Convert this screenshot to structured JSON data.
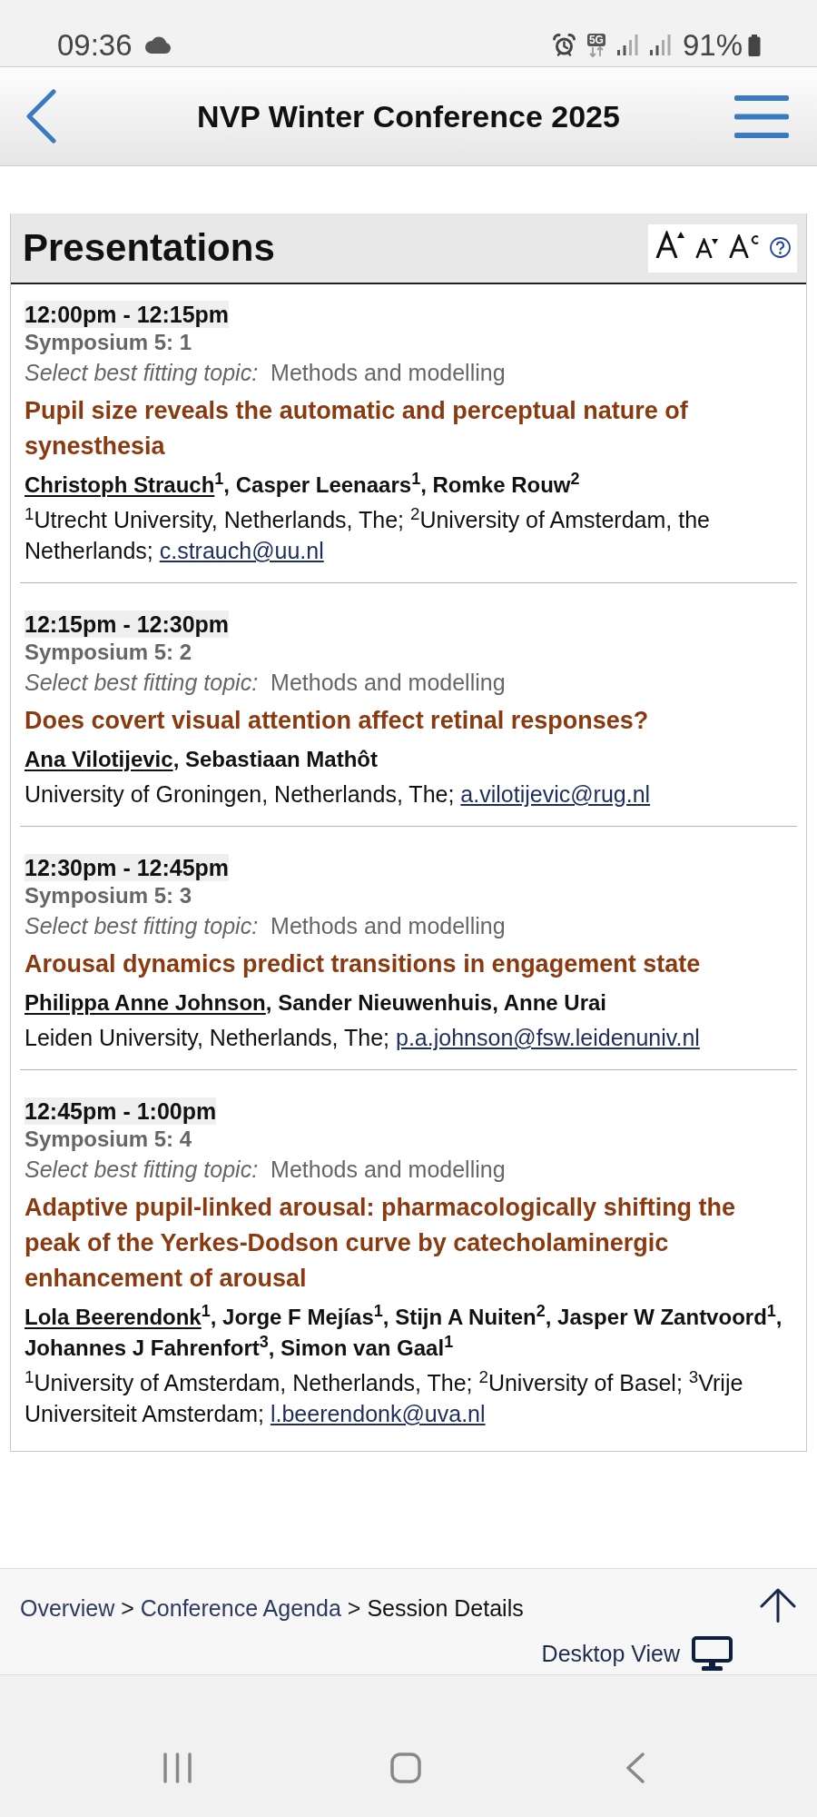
{
  "status_bar": {
    "time": "09:36",
    "network": "5G",
    "battery": "91%"
  },
  "header": {
    "title": "NVP Winter Conference 2025"
  },
  "section": {
    "title": "Presentations"
  },
  "presentations": [
    {
      "time": "12:00pm - 12:15pm",
      "session": "Symposium 5: 1",
      "topic_label": "Select best fitting topic:",
      "topic": "Methods and modelling",
      "title": "Pupil size reveals the automatic and perceptual nature of synesthesia",
      "authors": [
        {
          "name": "Christoph Strauch",
          "mark": "1",
          "presenting": true,
          "separator": ","
        },
        {
          "name": "Casper Leenaars",
          "mark": "1",
          "presenting": false,
          "separator": ","
        },
        {
          "name": "Romke Rouw",
          "mark": "2",
          "presenting": false
        }
      ],
      "affiliations": "$^{1}$Utrecht University, Netherlands, The; $^{2}$University of Amsterdam, the Netherlands;",
      "email": "c.strauch@uu.nl"
    },
    {
      "time": "12:15pm - 12:30pm",
      "session": "Symposium 5: 2",
      "topic_label": "Select best fitting topic:",
      "topic": "Methods and modelling",
      "title": "Does covert visual attention affect retinal responses?",
      "authors": [
        {
          "name": "Ana Vilotijevic",
          "presenting": true,
          "separator": ","
        },
        {
          "name": "Sebastiaan Mathôt",
          "presenting": false
        }
      ],
      "affiliations": "University of Groningen, Netherlands, The;",
      "email": "a.vilotijevic@rug.nl"
    },
    {
      "time": "12:30pm - 12:45pm",
      "session": "Symposium 5: 3",
      "topic_label": "Select best fitting topic:",
      "topic": "Methods and modelling",
      "title": "Arousal dynamics predict transitions in engagement state",
      "authors": [
        {
          "name": "Philippa Anne Johnson",
          "presenting": true,
          "separator": ","
        },
        {
          "name": "Sander Nieuwenhuis",
          "presenting": false,
          "separator": ","
        },
        {
          "name": "Anne Urai",
          "presenting": false
        }
      ],
      "affiliations": "Leiden University, Netherlands, The;",
      "email": "p.a.johnson@fsw.leidenuniv.nl"
    },
    {
      "time": "12:45pm - 1:00pm",
      "session": "Symposium 5: 4",
      "topic_label": "Select best fitting topic:",
      "topic": "Methods and modelling",
      "title": "Adaptive pupil-linked arousal: pharmacologically shifting the peak of the Yerkes-Dodson curve by catecholaminergic enhancement of arousal",
      "authors": [
        {
          "name": "Lola Beerendonk",
          "mark": "1",
          "presenting": true,
          "separator": ","
        },
        {
          "name": "Jorge F Mejías",
          "mark": "1",
          "presenting": false,
          "separator": ","
        },
        {
          "name": "Stijn A Nuiten",
          "mark": "2",
          "presenting": false,
          "separator": ","
        },
        {
          "name": "Jasper W Zantvoord",
          "mark": "1",
          "presenting": false,
          "separator": ","
        },
        {
          "name": "Johannes J Fahrenfort",
          "mark": "3",
          "presenting": false,
          "separator": ","
        },
        {
          "name": "Simon van Gaal",
          "mark": "1",
          "presenting": false
        }
      ],
      "affiliations": "$^{1}$University of Amsterdam, Netherlands, The; $^{2}$University of Basel; $^{3}$Vrije Universiteit Amsterdam;",
      "email": "l.beerendonk@uva.nl"
    }
  ],
  "footer": {
    "breadcrumb": [
      {
        "kind": "link",
        "label": "Overview"
      },
      {
        "kind": "separator",
        "label": ">"
      },
      {
        "kind": "link",
        "label": "Conference Agenda"
      },
      {
        "kind": "separator",
        "label": ">"
      },
      {
        "kind": "current",
        "label": "Session Details"
      }
    ],
    "desktop_view": "Desktop View"
  }
}
